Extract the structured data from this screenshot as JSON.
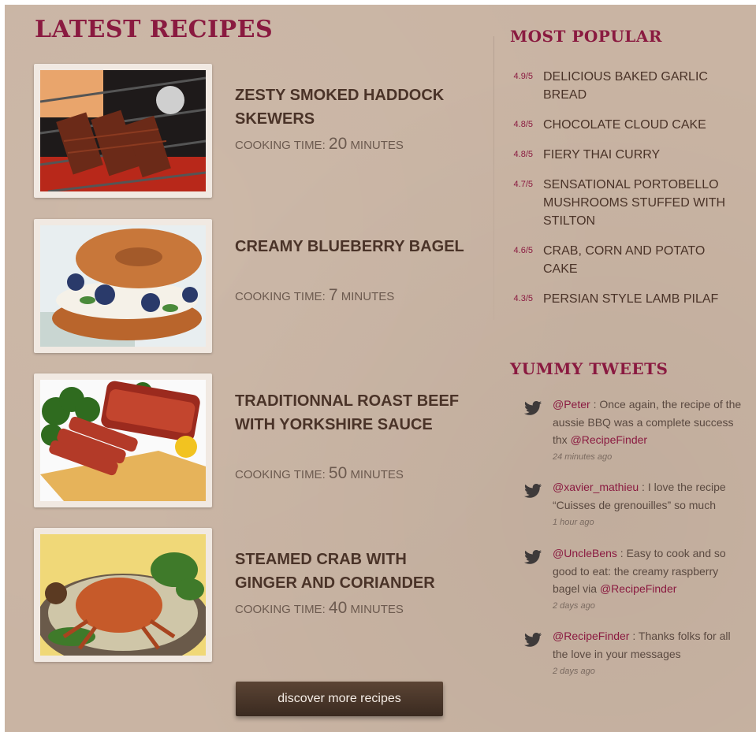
{
  "latest": {
    "heading": "LATEST RECIPES",
    "cook_prefix": "COOKING TIME:",
    "cook_suffix": "MINUTES",
    "recipes": [
      {
        "title": "ZESTY SMOKED HADDOCK SKEWERS",
        "minutes": "20",
        "image": "grilled-skewers-image"
      },
      {
        "title": "CREAMY BLUEBERRY BAGEL",
        "minutes": "7",
        "image": "blueberry-bagel-image"
      },
      {
        "title": "TRADITIONNAL ROAST BEEF WITH YORKSHIRE SAUCE",
        "minutes": "50",
        "image": "roast-beef-image"
      },
      {
        "title": "STEAMED CRAB WITH GINGER AND CORIANDER",
        "minutes": "40",
        "image": "steamed-crab-image"
      }
    ],
    "more_button": "discover more recipes"
  },
  "popular": {
    "heading": "MOST POPULAR",
    "items": [
      {
        "rating": "4.9/5",
        "name": "DELICIOUS BAKED GARLIC BREAD"
      },
      {
        "rating": "4.8/5",
        "name": "CHOCOLATE CLOUD CAKE"
      },
      {
        "rating": "4.8/5",
        "name": "FIERY THAI CURRY"
      },
      {
        "rating": "4.7/5",
        "name": "SENSATIONAL PORTOBELLO MUSHROOMS STUFFED WITH STILTON"
      },
      {
        "rating": "4.6/5",
        "name": "CRAB, CORN AND POTATO CAKE"
      },
      {
        "rating": "4.3/5",
        "name": "PERSIAN STYLE LAMB PILAF"
      }
    ]
  },
  "tweets": {
    "heading": "YUMMY TWEETS",
    "icon": "twitter-bird-icon",
    "items": [
      {
        "user": "@Peter",
        "text": " : Once again, the recipe of the aussie BBQ was a complete  success thx ",
        "mention": "@RecipeFinder",
        "time": "24 minutes ago"
      },
      {
        "user": "@xavier_mathieu",
        "text": " : I love the recipe “Cuisses de grenouilles” so much",
        "mention": "",
        "time": "1 hour ago"
      },
      {
        "user": "@UncleBens",
        "text": " : Easy to cook and so good to eat: the creamy raspberry bagel via ",
        "mention": "@RecipeFinder",
        "time": "2 days ago"
      },
      {
        "user": "@RecipeFinder",
        "text": " : Thanks folks for all the love in your messages",
        "mention": "",
        "time": "2 days ago"
      }
    ]
  },
  "colors": {
    "background": "#c9b4a3",
    "accent": "#8a1a40",
    "text": "#4a3328",
    "button": "#4a3628"
  }
}
